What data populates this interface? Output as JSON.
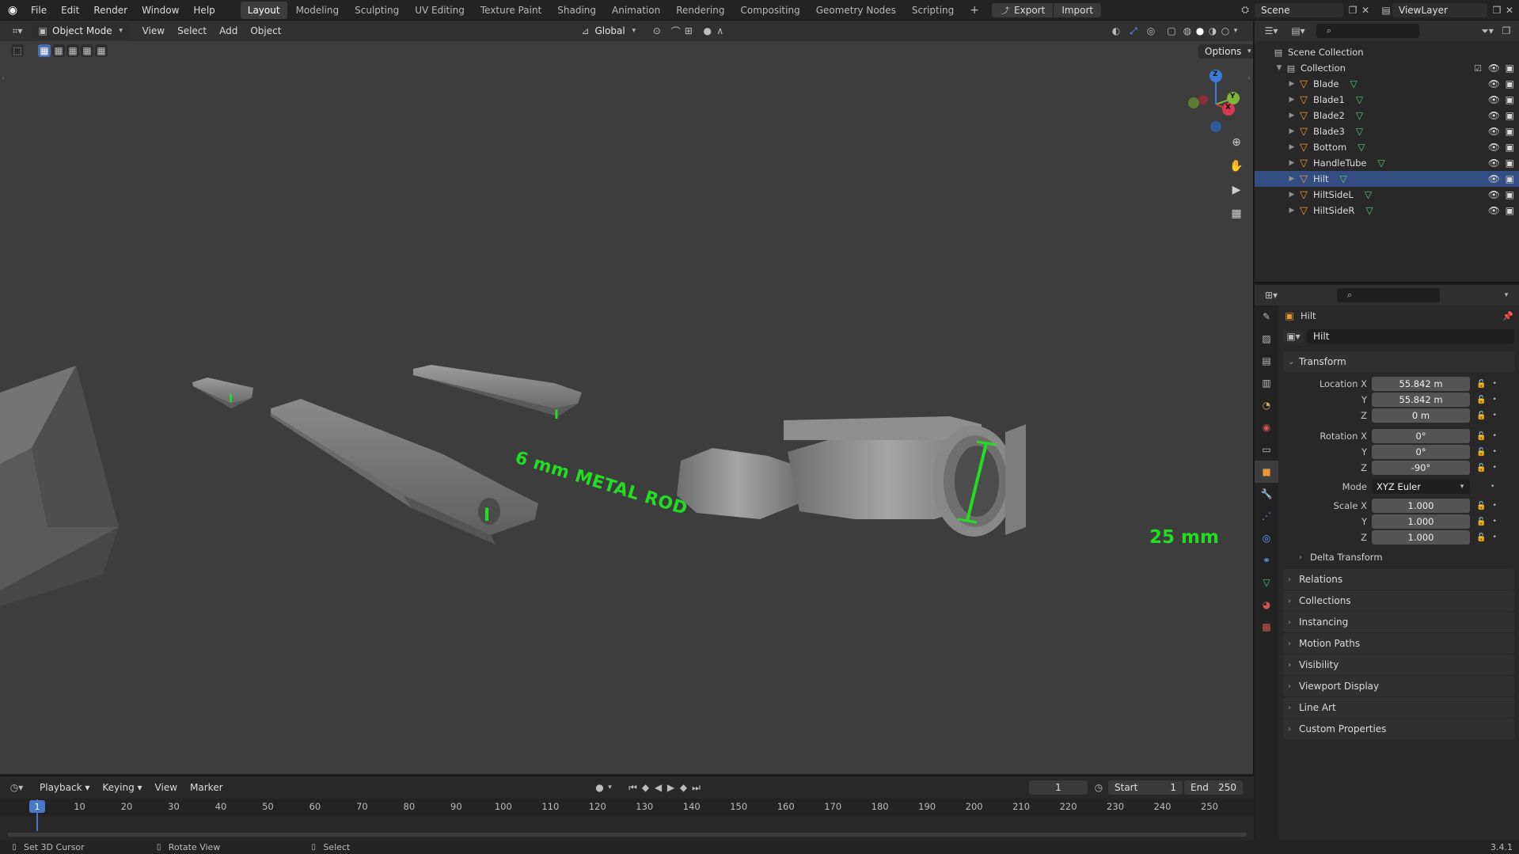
{
  "topbar": {
    "menus": [
      "File",
      "Edit",
      "Render",
      "Window",
      "Help"
    ],
    "workspaces": [
      "Layout",
      "Modeling",
      "Sculpting",
      "UV Editing",
      "Texture Paint",
      "Shading",
      "Animation",
      "Rendering",
      "Compositing",
      "Geometry Nodes",
      "Scripting"
    ],
    "active_workspace": "Layout",
    "add_workspace": "+",
    "export_label": "Export",
    "import_label": "Import",
    "scene_label": "Scene",
    "view_layer_label": "ViewLayer"
  },
  "viewport": {
    "mode_label": "Object Mode",
    "menus": [
      "View",
      "Select",
      "Add",
      "Object"
    ],
    "orientation_label": "Global",
    "options_label": "Options",
    "gizmo_axes": {
      "x": "X",
      "y": "Y",
      "z": "Z"
    },
    "annotations": {
      "rod_label": "6 mm METAL ROD",
      "diameter_label": "25 mm"
    },
    "annotation_color": "#22dd22"
  },
  "outliner": {
    "scene_collection": "Scene Collection",
    "collection": "Collection",
    "objects": [
      "Blade",
      "Blade1",
      "Blade2",
      "Blade3",
      "Bottom",
      "HandleTube",
      "Hilt",
      "HiltSideL",
      "HiltSideR"
    ],
    "selected": "Hilt"
  },
  "properties": {
    "object_name": "Hilt",
    "object_field": "Hilt",
    "transform_header": "Transform",
    "location": {
      "label_x": "Location X",
      "label_y": "Y",
      "label_z": "Z",
      "x": "55.842 m",
      "y": "55.842 m",
      "z": "0 m"
    },
    "rotation": {
      "label_x": "Rotation X",
      "label_y": "Y",
      "label_z": "Z",
      "x": "0°",
      "y": "0°",
      "z": "-90°"
    },
    "mode": {
      "label": "Mode",
      "value": "XYZ Euler"
    },
    "scale": {
      "label_x": "Scale X",
      "label_y": "Y",
      "label_z": "Z",
      "x": "1.000",
      "y": "1.000",
      "z": "1.000"
    },
    "delta_transform": "Delta Transform",
    "panels": [
      "Relations",
      "Collections",
      "Instancing",
      "Motion Paths",
      "Visibility",
      "Viewport Display",
      "Line Art",
      "Custom Properties"
    ]
  },
  "timeline": {
    "menus": [
      "Playback",
      "Keying",
      "View",
      "Marker"
    ],
    "current_frame": "1",
    "start_label": "Start",
    "start_value": "1",
    "end_label": "End",
    "end_value": "250",
    "ruler_ticks": [
      "1",
      "10",
      "20",
      "30",
      "40",
      "50",
      "60",
      "70",
      "80",
      "90",
      "100",
      "110",
      "120",
      "130",
      "140",
      "150",
      "160",
      "170",
      "180",
      "190",
      "200",
      "210",
      "220",
      "230",
      "240",
      "250"
    ]
  },
  "statusbar": {
    "left": "Set 3D Cursor",
    "middle": "Rotate View",
    "right": "Select",
    "version": "3.4.1"
  }
}
